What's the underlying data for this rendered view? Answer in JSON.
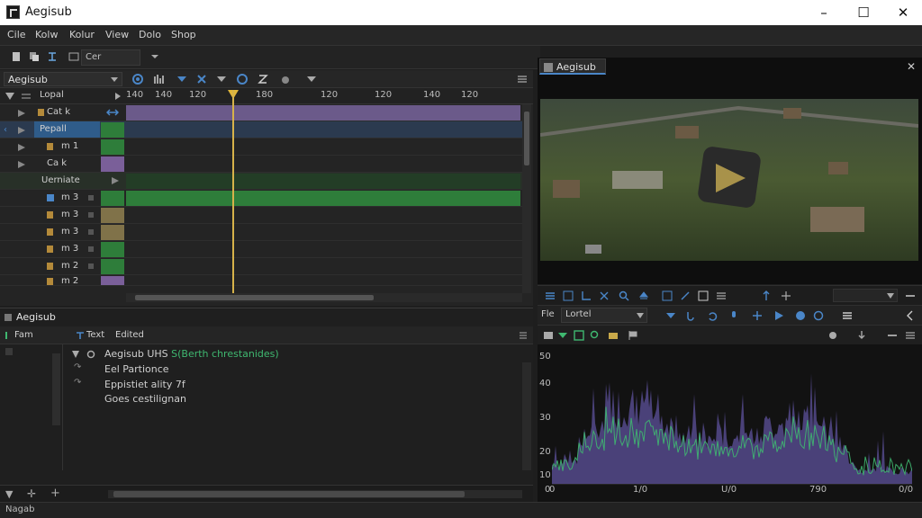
{
  "window": {
    "title": "Aegisub"
  },
  "menu": [
    "Cile",
    "Kolw",
    "Kolur",
    "View",
    "Dolo",
    "Shop"
  ],
  "toolbar": {
    "combo_value": "Cer"
  },
  "timeline": {
    "project_combo": "Aegisub",
    "ruler_labels": [
      "140",
      "140",
      "120",
      "180",
      "120",
      "120",
      "140",
      "120"
    ],
    "tracks": [
      {
        "name": "Lopal",
        "color": ""
      },
      {
        "name": "Cat k",
        "color": "#7a5f99"
      },
      {
        "name": "Pepall",
        "color": "#2e7d3a"
      },
      {
        "name": "m 1",
        "color": "#2e7d3a"
      },
      {
        "name": "Ca k",
        "color": "#7a5f99"
      },
      {
        "name": "Uerniate",
        "color": ""
      },
      {
        "name": "m 3",
        "color": "#2e7d3a"
      },
      {
        "name": "m 3",
        "color": "#807249"
      },
      {
        "name": "m 3",
        "color": "#807249"
      },
      {
        "name": "m 3",
        "color": "#2e7d3a"
      },
      {
        "name": "m 2",
        "color": "#2e7d3a"
      },
      {
        "name": "m 2",
        "color": "#7a5f99"
      }
    ]
  },
  "subpanel": {
    "tab_label": "Aegisub",
    "left_label": "Fam",
    "header_text": "Text",
    "header_edited": "Edited",
    "lines": [
      {
        "prefix": "Aegisub UHS ",
        "accent": "S(Berth chrestanides)"
      },
      {
        "prefix": "Eel Partionce",
        "accent": ""
      },
      {
        "prefix": "Eppistiet ality 7f",
        "accent": ""
      },
      {
        "prefix": "Goes cestilignan",
        "accent": ""
      }
    ]
  },
  "video": {
    "tab_label": "Aegisub"
  },
  "style_bar": {
    "label": "Fle",
    "combo_value": "Lortel"
  },
  "waveform": {
    "y_ticks": [
      "50",
      "40",
      "30",
      "20",
      "10",
      "0"
    ],
    "x_ticks": [
      "0",
      "1/0",
      "U/0",
      "790",
      "0/0"
    ]
  },
  "status": {
    "text": "Nagab"
  },
  "colors": {
    "accent_blue": "#4a86c8",
    "clip_purple": "#6b5a8a",
    "clip_green": "#2e7d3a",
    "playhead": "#e0b63a",
    "wave_purple": "#5a4d8f",
    "wave_green": "#3fb870"
  }
}
